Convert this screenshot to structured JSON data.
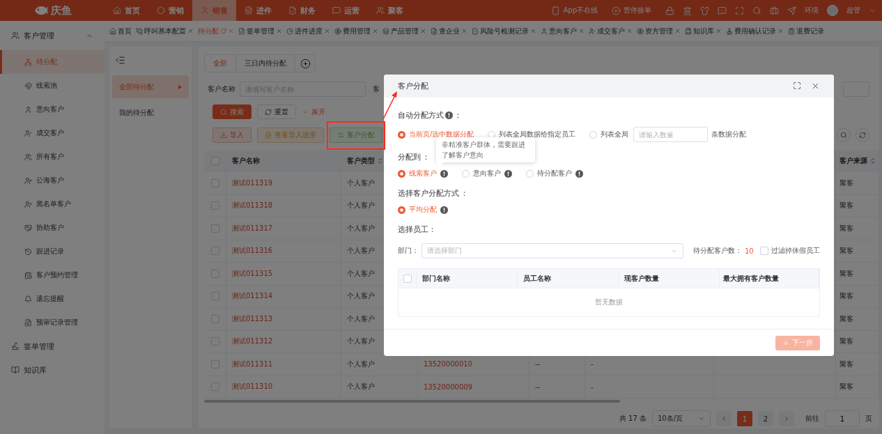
{
  "topbar": {
    "logo": "庆鱼",
    "nav": [
      {
        "label": "首页",
        "selected": false
      },
      {
        "label": "营销",
        "selected": false
      },
      {
        "label": "销售",
        "selected": true
      },
      {
        "label": "进件",
        "selected": false
      },
      {
        "label": "财务",
        "selected": false
      },
      {
        "label": "运营",
        "selected": false
      },
      {
        "label": "聚客",
        "selected": false
      }
    ],
    "status": [
      "App不在线",
      "暂停接单"
    ],
    "env": "环境",
    "user": "超管"
  },
  "tabs": [
    {
      "label": "首页",
      "selected": false,
      "closable": false
    },
    {
      "label": "呼叫基本配置",
      "selected": false,
      "closable": true
    },
    {
      "label": "待分配",
      "selected": true,
      "closable": true
    },
    {
      "label": "签单管理",
      "selected": false,
      "closable": true
    },
    {
      "label": "进件进度",
      "selected": false,
      "closable": true
    },
    {
      "label": "费用管理",
      "selected": false,
      "closable": true
    },
    {
      "label": "产品管理",
      "selected": false,
      "closable": true
    },
    {
      "label": "查企业",
      "selected": false,
      "closable": true
    },
    {
      "label": "风险号检测记录",
      "selected": false,
      "closable": true
    },
    {
      "label": "意向客户",
      "selected": false,
      "closable": true
    },
    {
      "label": "成交客户",
      "selected": false,
      "closable": true
    },
    {
      "label": "资方管理",
      "selected": false,
      "closable": true
    },
    {
      "label": "知识库",
      "selected": false,
      "closable": true
    },
    {
      "label": "费用确认记录",
      "selected": false,
      "closable": true
    },
    {
      "label": "退费记录",
      "selected": false,
      "closable": false
    }
  ],
  "sidebar": {
    "items": [
      {
        "label": "客户管理",
        "expanded": true,
        "children": [
          {
            "label": "待分配",
            "selected": true
          },
          {
            "label": "线索池",
            "selected": false
          },
          {
            "label": "意向客户",
            "selected": false
          },
          {
            "label": "成交客户",
            "selected": false
          },
          {
            "label": "所有客户",
            "selected": false
          },
          {
            "label": "公海客户",
            "selected": false
          },
          {
            "label": "黑名单客户",
            "selected": false
          },
          {
            "label": "协助客户",
            "selected": false
          },
          {
            "label": "跟进记录",
            "selected": false
          },
          {
            "label": "客户预约管理",
            "selected": false
          },
          {
            "label": "遗忘提醒",
            "selected": false
          },
          {
            "label": "预审记录管理",
            "selected": false
          }
        ]
      },
      {
        "label": "签单管理"
      },
      {
        "label": "知识库"
      }
    ]
  },
  "subnav": {
    "items": [
      {
        "label": "全部待分配",
        "selected": true
      },
      {
        "label": "我的待分配",
        "selected": false
      }
    ]
  },
  "content": {
    "tabs": [
      {
        "label": "全部",
        "selected": true
      },
      {
        "label": "三日内待分配",
        "selected": false
      }
    ],
    "filters": [
      {
        "label": "客户名称",
        "placeholder": "请填写客户名称"
      },
      {
        "label": "客"
      }
    ],
    "actions": [
      {
        "label": "搜索",
        "kind": "primary"
      },
      {
        "label": "重置",
        "kind": "default"
      },
      {
        "label": "展开",
        "kind": "link"
      }
    ],
    "tools": [
      {
        "label": "导入",
        "kind": "import",
        "highlighted": false
      },
      {
        "label": "查看导入进度",
        "kind": "progress",
        "highlighted": false
      },
      {
        "label": "客户分配",
        "kind": "assign",
        "highlighted": true
      }
    ],
    "table": {
      "all_checked": false,
      "columns": [
        {
          "label": "客户名称",
          "sortable": false
        },
        {
          "label": "客户类型",
          "sortable": true
        },
        {
          "label": "客户来源",
          "sortable": true
        }
      ],
      "rows": [
        {
          "checked": false,
          "name": "测试011319",
          "type": "个人客户",
          "source": "聚客"
        },
        {
          "checked": false,
          "name": "测试011318",
          "type": "个人客户",
          "source": "聚客"
        },
        {
          "checked": false,
          "name": "测试011317",
          "type": "个人客户",
          "source": "聚客"
        },
        {
          "checked": false,
          "name": "测试011316",
          "type": "个人客户",
          "source": "聚客"
        },
        {
          "checked": false,
          "name": "测试011315",
          "type": "个人客户",
          "source": "聚客"
        },
        {
          "checked": false,
          "name": "测试011314",
          "type": "个人客户",
          "source": "聚客"
        },
        {
          "checked": false,
          "name": "测试011313",
          "type": "个人客户",
          "source": "聚客"
        },
        {
          "checked": false,
          "name": "测试011312",
          "type": "个人客户",
          "source": "聚客"
        },
        {
          "checked": false,
          "name": "测试011311",
          "type": "个人客户",
          "column_3": "13520000010",
          "column_4": "--",
          "column_5": "-",
          "source": "聚客"
        },
        {
          "checked": false,
          "name": "测试011310",
          "type": "个人客户",
          "column_3": "13520000009",
          "column_4": "--",
          "column_5": "-",
          "source": "聚客"
        }
      ]
    },
    "pagination": {
      "total": "共 17 条",
      "page_size": "10条/页",
      "pages": [
        {
          "label": "1",
          "selected": true
        },
        {
          "label": "2",
          "selected": false
        }
      ],
      "goto_label": "前往",
      "goto_value": "1",
      "goto_suffix": "页"
    }
  },
  "modal": {
    "title": "客户分配",
    "title_marked": true,
    "method": {
      "label": "自动分配方式",
      "info": true,
      "colon": "：",
      "options": [
        {
          "kind": "plain",
          "label": "当前页/选中数据分配",
          "selected": true
        },
        {
          "kind": "plain",
          "label": "列表全局数据给指定员工",
          "selected": false
        },
        {
          "kind": "count",
          "label": "列表全局",
          "placeholder": "请输入数量",
          "suffix": "条数据分配",
          "selected": false
        }
      ]
    },
    "assign_to": {
      "label": "分配到",
      "info": false,
      "colon": "：",
      "options": [
        {
          "kind": "info",
          "label": "线索客户",
          "selected": true
        },
        {
          "kind": "info",
          "label": "意向客户",
          "selected": false
        },
        {
          "kind": "info",
          "label": "待分配客户",
          "selected": false
        }
      ]
    },
    "split": {
      "label": "选择客户分配方式",
      "info": false,
      "colon": "：",
      "options": [
        {
          "kind": "info",
          "label": "平均分配",
          "selected": true
        }
      ]
    },
    "staff": {
      "all_checked": false,
      "label": "选择员工：",
      "dept_label": "部门：",
      "dept_placeholder": "请选择部门",
      "pending_label": "待分配客户数：",
      "pending_value": "10",
      "filter_label": "过滤掉休假员工",
      "filter_checked": false,
      "columns": [
        "部门名称",
        "员工名称",
        "现客户数量",
        "最大拥有客户数量"
      ],
      "empty": "暂无数据"
    },
    "next": "下一步",
    "tooltip": "非精准客户群体，需要跟进了解客户意向"
  }
}
